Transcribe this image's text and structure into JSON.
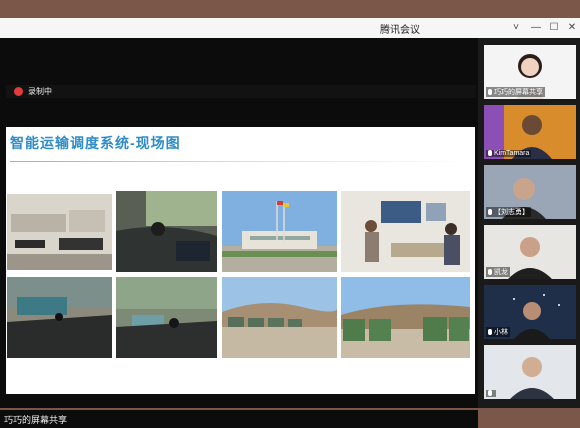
{
  "app": {
    "title": "腾讯会议",
    "colors": {
      "accent": "#2e8cc8",
      "record": "#e23b3b"
    }
  },
  "window_controls": {
    "chevron": "˅",
    "minimize": "—",
    "maximize": "☐",
    "close": "✕"
  },
  "recording": {
    "label": "录制中"
  },
  "slide": {
    "title": "智能运输调度系统-现场图",
    "photos": [
      "truck-cab-console",
      "driver-cab-monitor",
      "office-building-flags",
      "control-room-meeting",
      "cab-dashboard-1",
      "cab-dashboard-2",
      "mining-trucks-parked",
      "mining-trucks-row"
    ]
  },
  "share": {
    "label": "巧巧的屏幕共享"
  },
  "participants": [
    {
      "name": "巧巧的屏幕共享",
      "icon": "avatar-woman"
    },
    {
      "name": "KimTamara",
      "icon": "avatar-man"
    },
    {
      "name": "【刘志勇】",
      "icon": "avatar-man"
    },
    {
      "name": "凯龙",
      "icon": "avatar-man"
    },
    {
      "name": "小林",
      "icon": "avatar-man"
    },
    {
      "name": "",
      "icon": "avatar-man"
    }
  ]
}
